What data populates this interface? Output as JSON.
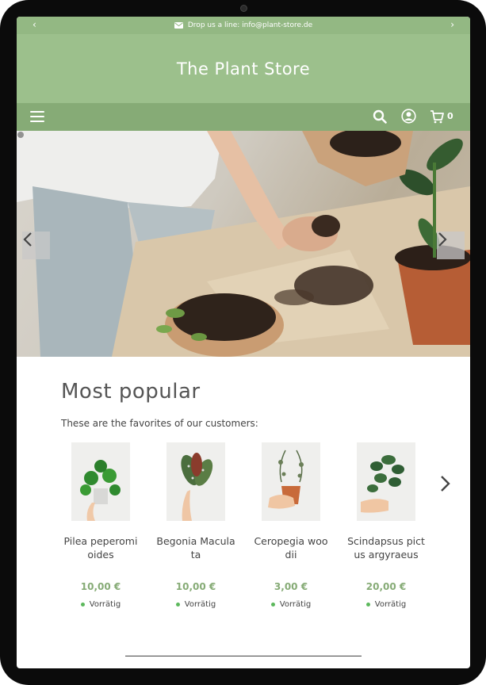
{
  "topbar": {
    "text": "Drop us a line: info@plant-store.de",
    "prev_icon": "chevron-left-icon",
    "next_icon": "chevron-right-icon",
    "mail_icon": "envelope-icon"
  },
  "header": {
    "title": "The Plant Store"
  },
  "nav": {
    "menu_icon": "hamburger-icon",
    "search_icon": "search-icon",
    "account_icon": "user-icon",
    "cart_icon": "cart-icon",
    "cart_count": "0"
  },
  "hero": {
    "prev_icon": "chevron-left-icon",
    "next_icon": "chevron-right-icon"
  },
  "section": {
    "title": "Most popular",
    "subtitle": "These are the favorites of our customers:"
  },
  "products": [
    {
      "name": "Pilea peperomioides",
      "price": "10,00 €",
      "stock": "Vorrätig"
    },
    {
      "name": "Begonia Maculata",
      "price": "10,00 €",
      "stock": "Vorrätig"
    },
    {
      "name": "Ceropegia woodii",
      "price": "3,00 €",
      "stock": "Vorrätig"
    },
    {
      "name": "Scindapsus pictus argyraeus",
      "price": "20,00 €",
      "stock": "Vorrätig"
    }
  ],
  "colors": {
    "topbar": "#93b883",
    "header": "#9cc08c",
    "nav": "#86ab76",
    "price": "#86ab76",
    "in_stock_dot": "#5cb85c"
  }
}
